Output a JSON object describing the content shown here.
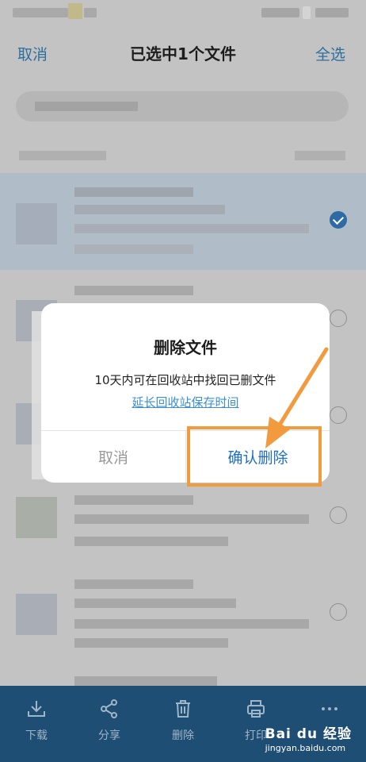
{
  "header": {
    "cancel_label": "取消",
    "title": "已选中1个文件",
    "select_all_label": "全选"
  },
  "dialog": {
    "title": "删除文件",
    "message": "10天内可在回收站中找回已删文件",
    "link": "延长回收站保存时间",
    "cancel_label": "取消",
    "confirm_label": "确认删除"
  },
  "toolbar": {
    "items": [
      {
        "label": "下载",
        "icon": "download-icon"
      },
      {
        "label": "分享",
        "icon": "share-icon"
      },
      {
        "label": "删除",
        "icon": "trash-icon"
      },
      {
        "label": "打印",
        "icon": "print-icon"
      },
      {
        "label": "",
        "icon": "more-icon"
      }
    ]
  },
  "watermark": {
    "logo": "Bai du 经验",
    "url": "jingyan.baidu.com"
  },
  "colors": {
    "accent_blue": "#1f6fc6",
    "toolbar_bg": "#1f4e74",
    "highlight_orange": "#f29a3e",
    "link_blue": "#3a8fd6"
  }
}
